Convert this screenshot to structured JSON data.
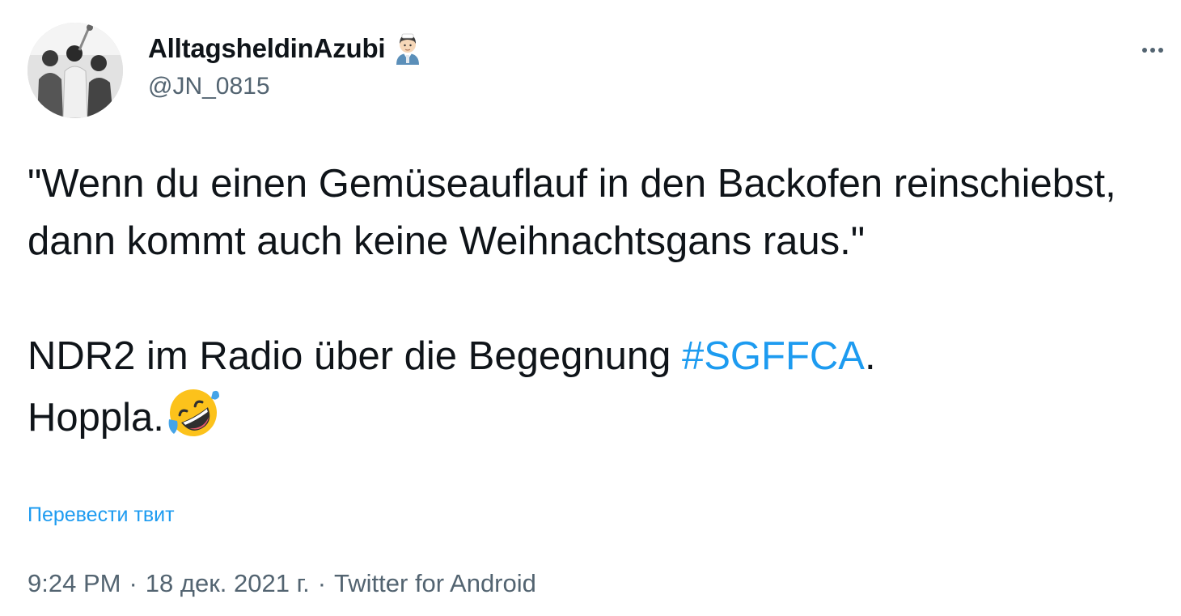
{
  "tweet": {
    "author": {
      "display_name": "AlltagsheldinAzubi",
      "handle": "@JN_0815",
      "name_emoji": "health-worker-emoji"
    },
    "text": {
      "line_quote": "\"Wenn du einen Gemüseauflauf in den Backofen reinschiebst, dann kommt auch keine Weihnachtsgans raus.\"",
      "line_ndr_prefix": "NDR2 im Radio über die Begegnung ",
      "hashtag": "#SGFFCA",
      "line_ndr_suffix": ".",
      "line_hoppla": "Hoppla.",
      "emoji": "rolling-on-floor-laughing-emoji"
    },
    "translate_label": "Перевести твит",
    "meta": {
      "time": "9:24 PM",
      "separator": "·",
      "date": "18 дек. 2021 г.",
      "source": "Twitter for Android"
    },
    "colors": {
      "text": "#0f1419",
      "secondary": "#536471",
      "link": "#1d9bf0"
    }
  }
}
